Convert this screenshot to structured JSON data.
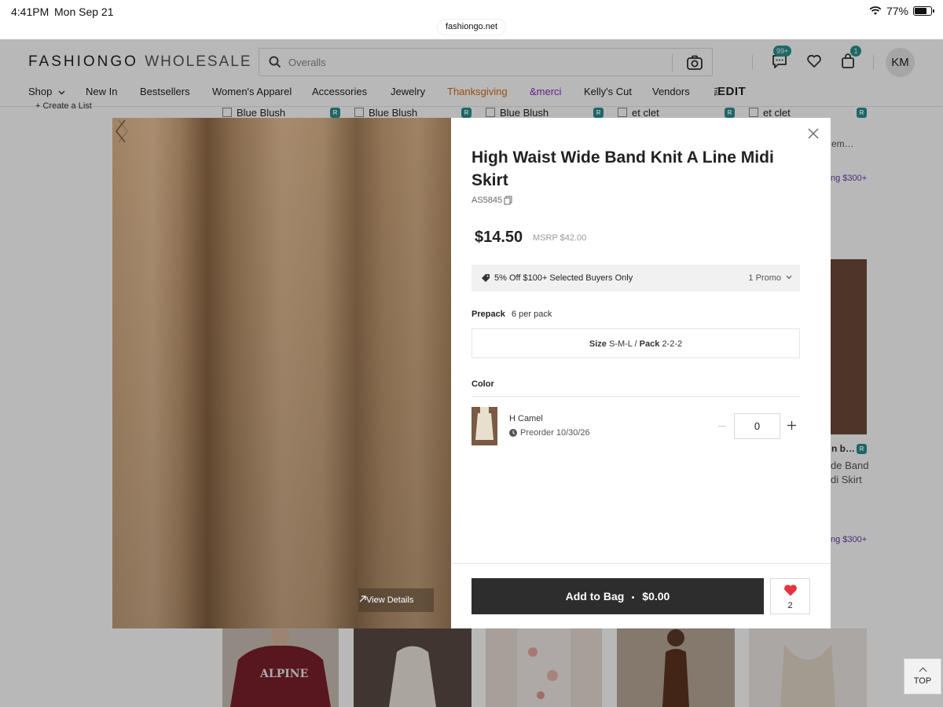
{
  "status_bar": {
    "time": "4:41PM",
    "date": "Mon Sep 21",
    "battery": "77%",
    "battery_level": 0.77,
    "url": "fashiongo.net"
  },
  "header": {
    "logo_main": "FASHIONGO",
    "logo_sub": "WHOLESALE",
    "search_placeholder": "Overalls",
    "messages_badge": "99+",
    "bag_badge": "1",
    "avatar": "KM"
  },
  "nav": [
    {
      "label": "Shop",
      "has_dropdown": true
    },
    {
      "label": "New In"
    },
    {
      "label": "Bestsellers"
    },
    {
      "label": "Women's Apparel"
    },
    {
      "label": "Accessories"
    },
    {
      "label": "Jewelry"
    },
    {
      "label": "Thanksgiving",
      "color": "#d96b13"
    },
    {
      "label": "&merci",
      "color": "#8b2bb8"
    },
    {
      "label": "Kelly's Cut"
    },
    {
      "label": "Vendors"
    },
    {
      "label": "EDIT",
      "prefix": "THE"
    }
  ],
  "background": {
    "create_list": "+ Create a List",
    "vendor_rows": [
      "Blue Blush",
      "Blue Blush",
      "Blue Blush",
      "et clet",
      "et clet"
    ],
    "side_text_1": "em…",
    "side_promo_1": "ng $300+",
    "side_text_2": "n b…",
    "side_text_3": "de Band",
    "side_text_4": "di Skirt",
    "side_promo_2": "ng $300+",
    "top_button": "TOP"
  },
  "modal": {
    "view_details": "View Details",
    "title": "High Waist Wide Band Knit A Line Midi Skirt",
    "sku": "AS5845",
    "price": "$14.50",
    "msrp": "MSRP $42.00",
    "promo_text": "5% Off $100+ Selected Buyers Only",
    "promo_count": "1 Promo",
    "prepack_label": "Prepack",
    "prepack_value": "6 per pack",
    "size_label": "Size",
    "size_value": "S-M-L",
    "pack_label": "Pack",
    "pack_value": "2-2-2",
    "color_label": "Color",
    "color_name": "H Camel",
    "preorder": "Preorder 10/30/26",
    "quantity": "0",
    "add_to_bag": "Add to Bag",
    "bag_total": "$0.00",
    "wishlist_count": "2",
    "colors": {
      "button_dark": "#2d2d2d",
      "heart": "#e8323c",
      "badge_teal": "#2a8f8f",
      "fabric": "#a88a6a"
    }
  }
}
